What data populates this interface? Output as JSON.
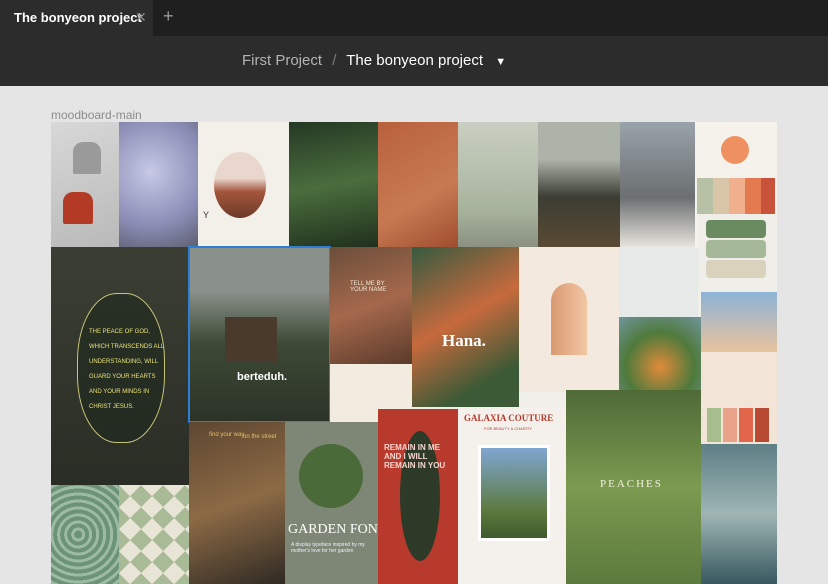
{
  "tabs": [
    {
      "label": "The bonyeon project",
      "close_icon": "close-icon"
    }
  ],
  "new_tab_icon": "plus-icon",
  "breadcrumb": {
    "parent": "First Project",
    "separator": "/",
    "current": "The bonyeon project",
    "chevron": "chevron-down-icon"
  },
  "frame": {
    "label": "moodboard-main"
  },
  "tiles": {
    "bonyeon_text": "Y",
    "poem": [
      "THE PEACE OF GOD,",
      "WHICH TRANSCENDS ALL",
      "UNDERSTANDING, WILL",
      "GUARD YOUR HEARTS",
      "AND YOUR MINDS IN",
      "CHRIST JESUS."
    ],
    "berteduh": "berteduh.",
    "tell_me": "TELL ME BY YOUR NAME",
    "hana": "Hana.",
    "galaxia": "GALAXIA COUTURE",
    "galaxia_sub": "FOR BEAUTY & CHARITY",
    "garden": "GARDEN FONT",
    "garden_sub": "A display typeface inspired by my mother's love for her garden",
    "peaches": "PEACHES",
    "remain": "REMAIN IN ME AND I WILL REMAIN IN YOU",
    "find_your_way": "find your way",
    "on_street": "on the street"
  }
}
